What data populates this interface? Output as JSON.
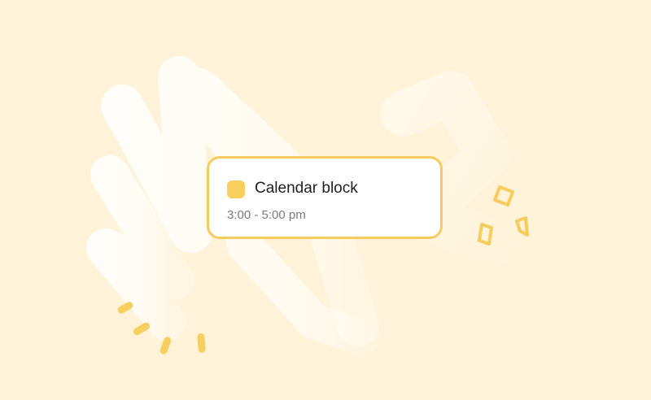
{
  "colors": {
    "background": "#FEF3D8",
    "scribble": "#FFFFFF",
    "accent": "#F6CC5C",
    "title_text": "#1E1E1E",
    "time_text": "#7A7A7A"
  },
  "calendar_block": {
    "title": "Calendar block",
    "time": "3:00 - 5:00 pm",
    "swatch_color": "#F7CF5E"
  },
  "decorations": {
    "left": "dash-marks",
    "right": "sparkle-marks"
  }
}
